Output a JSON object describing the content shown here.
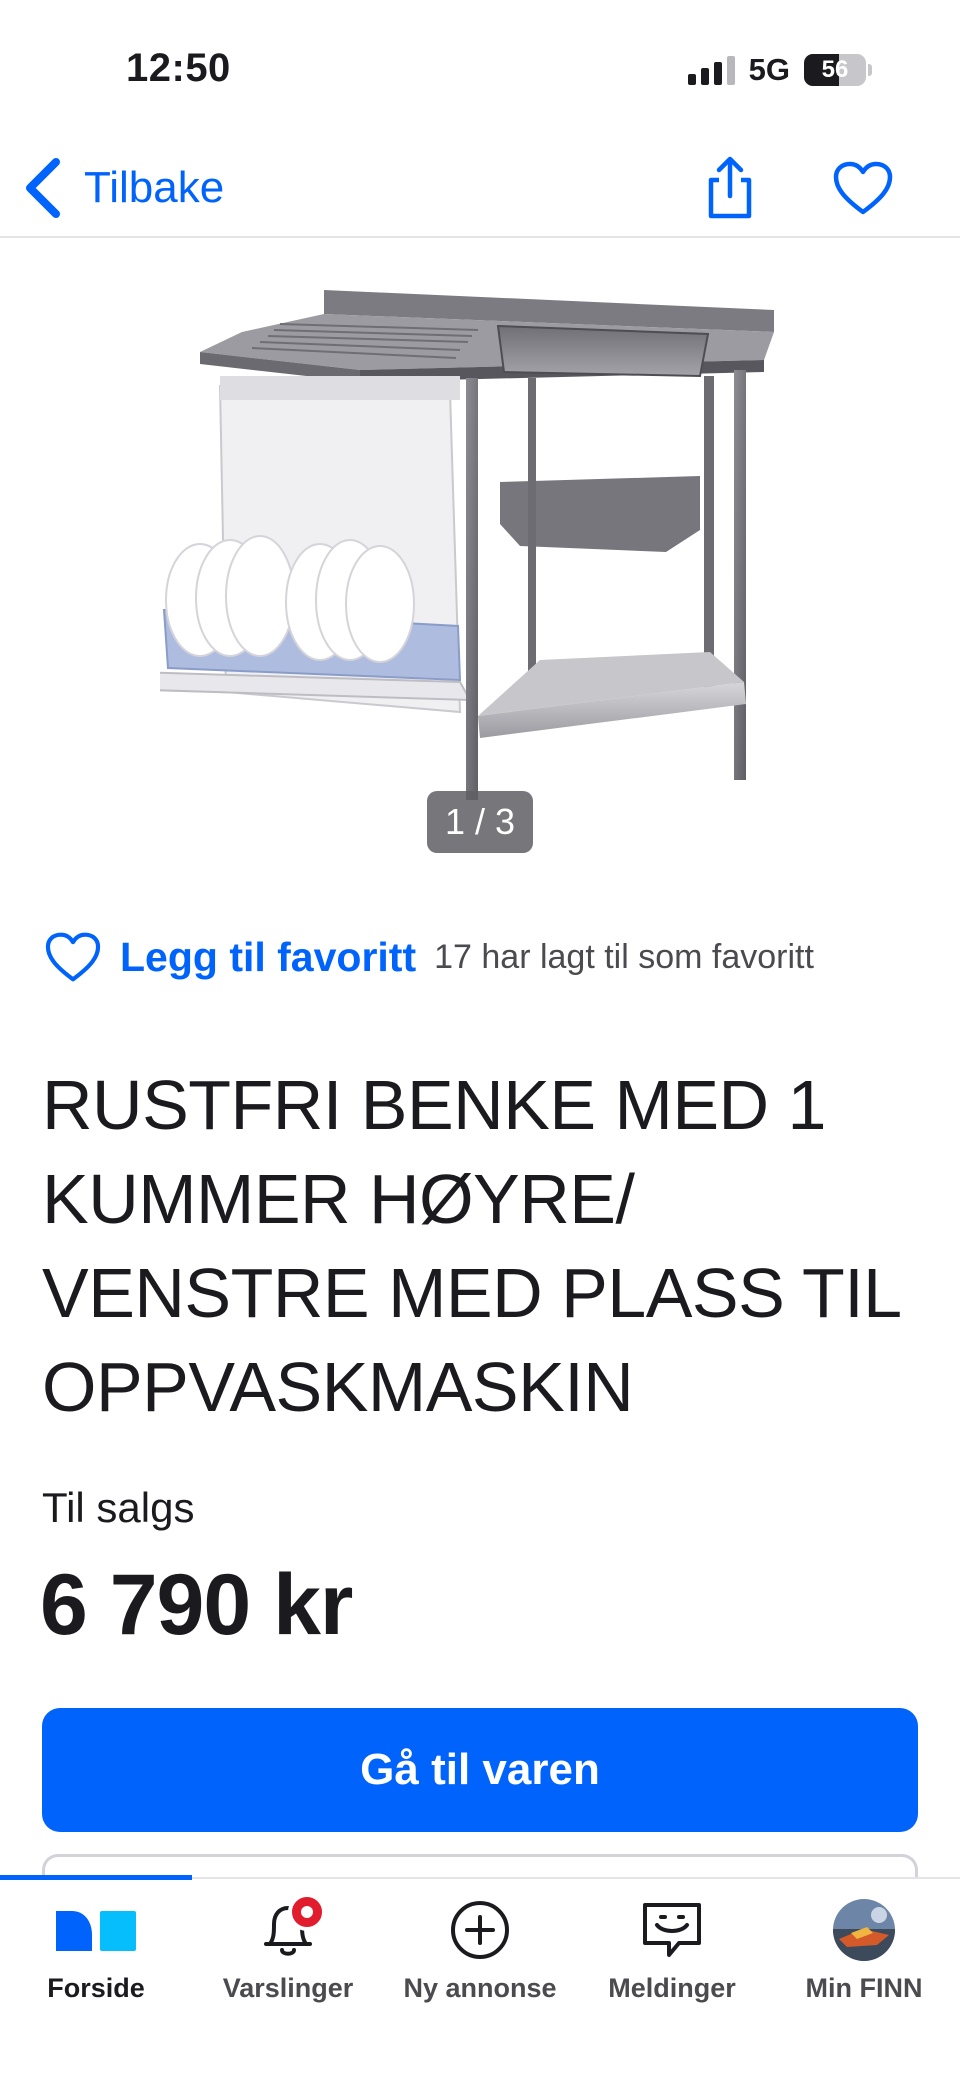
{
  "status_bar": {
    "time": "12:50",
    "network": "5G",
    "battery_level": "56",
    "battery_fraction": 0.56
  },
  "nav": {
    "back_label": "Tilbake",
    "icons": [
      "chevron-left-icon",
      "share-icon",
      "heart-icon"
    ],
    "accent_color": "#0063fb"
  },
  "gallery": {
    "counter": "1 / 3"
  },
  "favorite": {
    "add_label": "Legg til favoritt",
    "count_text": "17 har lagt til som favoritt"
  },
  "ad": {
    "title": "RUSTFRI BENKE MED 1 KUMMER HØYRE/ VENSTRE MED PLASS TIL OPPVASKMASKIN",
    "sale_type": "Til salgs",
    "price": "6 790 kr",
    "cta_label": "Gå til varen"
  },
  "tab_bar": {
    "items": [
      {
        "label": "Forside",
        "icon": "finn-logo-icon",
        "active": true
      },
      {
        "label": "Varslinger",
        "icon": "bell-icon",
        "badge": true
      },
      {
        "label": "Ny annonse",
        "icon": "plus-circle-icon"
      },
      {
        "label": "Meldinger",
        "icon": "chat-smile-icon"
      },
      {
        "label": "Min FINN",
        "icon": "avatar"
      }
    ],
    "badge_color": "#e11c2c"
  }
}
